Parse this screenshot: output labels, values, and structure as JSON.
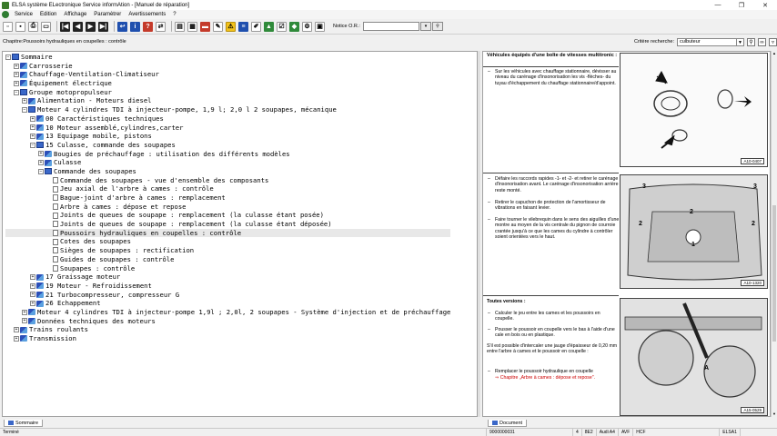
{
  "window": {
    "title": "ELSA système ELectronique Service informAtion - [Manuel de réparation]",
    "minimize": "—",
    "maximize": "❐",
    "close": "✕"
  },
  "menu": [
    "Service",
    "Edition",
    "Affichage",
    "Paramètrer",
    "Avertissements",
    "?"
  ],
  "toolbar": {
    "notice_label": "Notice O.R.:",
    "notice_value": ""
  },
  "breadcrumb": "Chapitre:Poussoirs hydrauliques en coupelles : contrôle",
  "search": {
    "label": "Critère recherche:",
    "value": "culbuteur"
  },
  "tree": [
    {
      "level": 0,
      "exp": "−",
      "icon": "open",
      "label": "Sommaire"
    },
    {
      "level": 1,
      "exp": "+",
      "icon": "book",
      "label": "Carrosserie"
    },
    {
      "level": 1,
      "exp": "+",
      "icon": "book",
      "label": "Chauffage-Ventilation-Climatiseur"
    },
    {
      "level": 1,
      "exp": "+",
      "icon": "book",
      "label": "Équipement électrique"
    },
    {
      "level": 1,
      "exp": "−",
      "icon": "open",
      "label": "Groupe motopropulseur"
    },
    {
      "level": 2,
      "exp": "+",
      "icon": "book",
      "label": "Alimentation - Moteurs diesel"
    },
    {
      "level": 2,
      "exp": "−",
      "icon": "open",
      "label": "Moteur 4 cylindres TDI à injecteur-pompe, 1,9 l; 2,0 l 2 soupapes, mécanique"
    },
    {
      "level": 3,
      "exp": "+",
      "icon": "book",
      "label": "00 Caractéristiques techniques"
    },
    {
      "level": 3,
      "exp": "+",
      "icon": "book",
      "label": "10 Moteur assemblé,cylindres,carter"
    },
    {
      "level": 3,
      "exp": "+",
      "icon": "book",
      "label": "13 Equipage mobile, pistons"
    },
    {
      "level": 3,
      "exp": "−",
      "icon": "open",
      "label": "15 Culasse, commande des soupapes"
    },
    {
      "level": 4,
      "exp": "+",
      "icon": "book",
      "label": "Bougies de préchauffage : utilisation des différents modèles"
    },
    {
      "level": 4,
      "exp": "+",
      "icon": "book",
      "label": "Culasse"
    },
    {
      "level": 4,
      "exp": "−",
      "icon": "open",
      "label": "Commande des soupapes"
    },
    {
      "level": 5,
      "exp": "",
      "icon": "page",
      "label": "Commande des soupapes - vue d'ensemble des composants"
    },
    {
      "level": 5,
      "exp": "",
      "icon": "page",
      "label": "Jeu axial de l'arbre à cames : contrôle"
    },
    {
      "level": 5,
      "exp": "",
      "icon": "page",
      "label": "Bague-joint d'arbre à cames : remplacement"
    },
    {
      "level": 5,
      "exp": "",
      "icon": "page",
      "label": "Arbre à cames : dépose et repose"
    },
    {
      "level": 5,
      "exp": "",
      "icon": "page",
      "label": "Joints de queues de soupape : remplacement (la culasse étant posée)"
    },
    {
      "level": 5,
      "exp": "",
      "icon": "page",
      "label": "Joints de queues de soupape : remplacement (la culasse étant déposée)"
    },
    {
      "level": 5,
      "exp": "",
      "icon": "page",
      "label": "Poussoirs hydrauliques en coupelles : contrôle",
      "selected": true
    },
    {
      "level": 5,
      "exp": "",
      "icon": "page",
      "label": "Cotes des soupapes"
    },
    {
      "level": 5,
      "exp": "",
      "icon": "page",
      "label": "Sièges de soupapes : rectification"
    },
    {
      "level": 5,
      "exp": "",
      "icon": "page",
      "label": "Guides de soupapes : contrôle"
    },
    {
      "level": 5,
      "exp": "",
      "icon": "page",
      "label": "Soupapes : contrôle"
    },
    {
      "level": 3,
      "exp": "+",
      "icon": "book",
      "label": "17 Graissage moteur"
    },
    {
      "level": 3,
      "exp": "+",
      "icon": "book",
      "label": "19 Moteur - Refroidissement"
    },
    {
      "level": 3,
      "exp": "+",
      "icon": "book",
      "label": "21 Turbocompresseur, compresseur G"
    },
    {
      "level": 3,
      "exp": "+",
      "icon": "book",
      "label": "26 Echappement"
    },
    {
      "level": 2,
      "exp": "+",
      "icon": "book",
      "label": "Moteur 4 cylindres TDI à injecteur-pompe 1,9l ; 2,0l, 2 soupapes - Système d'injection et de préchauffage"
    },
    {
      "level": 2,
      "exp": "+",
      "icon": "book",
      "label": "Données techniques des moteurs"
    },
    {
      "level": 1,
      "exp": "+",
      "icon": "book",
      "label": "Trains roulants"
    },
    {
      "level": 1,
      "exp": "+",
      "icon": "book",
      "label": "Transmission"
    }
  ],
  "doc": {
    "heading": "Véhicules équipés d'une boîte de vitesses multitronic :",
    "b1": "Sur les véhicules avec chauffage stationnaire, dévisser au niveau du carénage d'insonorisation les vis -flèches- du tuyau d'échappement du chauffage stationnaire/d'appoint.",
    "fig1": "A10-0407",
    "b2": "Défaire les raccords rapides -1- et -2- et retirer le carénage d'insonorisation avant. Le carénage d'insonorisation arrière reste monté.",
    "b3": "Retirer le capuchon de protection de l'amortisseur de vibrations en faisant levier.",
    "b4": "Faire tourner le vilebrequin dans le sens des aiguilles d'une montre au moyen de la vis centrale du pignon de courroie crantée jusqu'à ce que les cames du cylindre à contrôler soient orientées vers le haut.",
    "fig2": "A10-1320",
    "heading2": "Toutes versions :",
    "b5": "Calculer le jeu entre les cames et les poussoirs en coupelle.",
    "b6": "Pousser le poussoir en coupelle vers le bas à l'aide d'une cale en bois ou en plastique.",
    "p1": "S'il est possible d'intercaler une jauge d'épaisseur de 0,20 mm entre l'arbre à cames et le poussoir en coupelle :",
    "b7": "Remplacer le poussoir hydraulique en coupelle",
    "link": "⇒ Chapitre „Arbre à cames : dépose et repose\".",
    "fig3": "A15-0529",
    "bullet": "–"
  },
  "tabs": {
    "left": "Sommaire",
    "right": "Document"
  },
  "status": {
    "state": "Terminé",
    "id": "9000000031",
    "f1": "4",
    "f2": "8E2",
    "f3": "Audi A4",
    "f4": "AVF",
    "f5": "HCF",
    "app": "ELSA1"
  }
}
